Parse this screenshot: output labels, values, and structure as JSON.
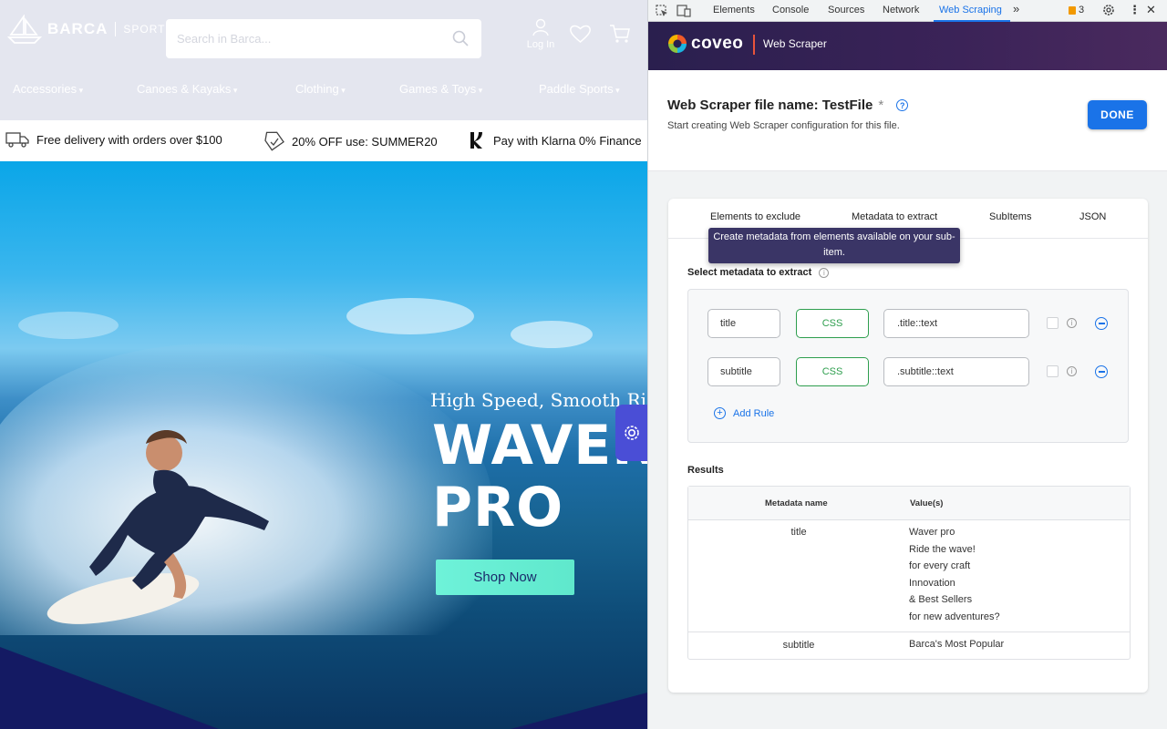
{
  "store": {
    "logo_text": "BARCA",
    "logo_sub": "SPORTS",
    "search_placeholder": "Search in Barca...",
    "login_label": "Log In",
    "categories": [
      "Accessories",
      "Canoes & Kayaks",
      "Clothing",
      "Games & Toys",
      "Paddle Sports"
    ],
    "promos": [
      {
        "icon": "truck-icon",
        "text": "Free delivery with orders over $100"
      },
      {
        "icon": "tag-icon",
        "text": "20% OFF use: SUMMER20"
      },
      {
        "icon": "klarna-icon",
        "text": "Pay with Klarna 0% Finance"
      }
    ],
    "hero": {
      "tagline": "High Speed, Smooth Ride",
      "title_line1": "WAVER",
      "title_line2": "PRO",
      "cta": "Shop Now"
    }
  },
  "devtools": {
    "tabs": [
      "Elements",
      "Console",
      "Sources",
      "Network",
      "Web Scraping"
    ],
    "active_tab": "Web Scraping",
    "warning_count": "3",
    "colors": {
      "active": "#1a73e8",
      "warning": "#f29900"
    }
  },
  "scraper": {
    "brand": "coveo",
    "app_name": "Web Scraper",
    "file_title": "Web Scraper file name: TestFile",
    "required_mark": "*",
    "subtitle": "Start creating Web Scraper configuration for this file.",
    "done_label": "DONE",
    "tabs": [
      "Elements to exclude",
      "Metadata to extract",
      "SubItems",
      "JSON"
    ],
    "tooltip": "Create metadata from elements available on your sub-item.",
    "select_label": "Select metadata to extract",
    "rules": [
      {
        "name": "title",
        "type": "CSS",
        "selector": ".title::text"
      },
      {
        "name": "subtitle",
        "type": "CSS",
        "selector": ".subtitle::text"
      }
    ],
    "add_rule_label": "Add Rule",
    "results_label": "Results",
    "results_columns": [
      "Metadata name",
      "Value(s)"
    ],
    "results": [
      {
        "name": "title",
        "values": [
          "Waver pro",
          "Ride the wave!",
          "for every craft",
          "Innovation",
          "& Best Sellers",
          "for new adventures?"
        ]
      },
      {
        "name": "subtitle",
        "values": [
          "Barca's Most Popular"
        ]
      }
    ],
    "colors": {
      "css_type": "#2e9e4e",
      "primary": "#1a73e8",
      "header_bg": "#2a1f4e"
    }
  }
}
